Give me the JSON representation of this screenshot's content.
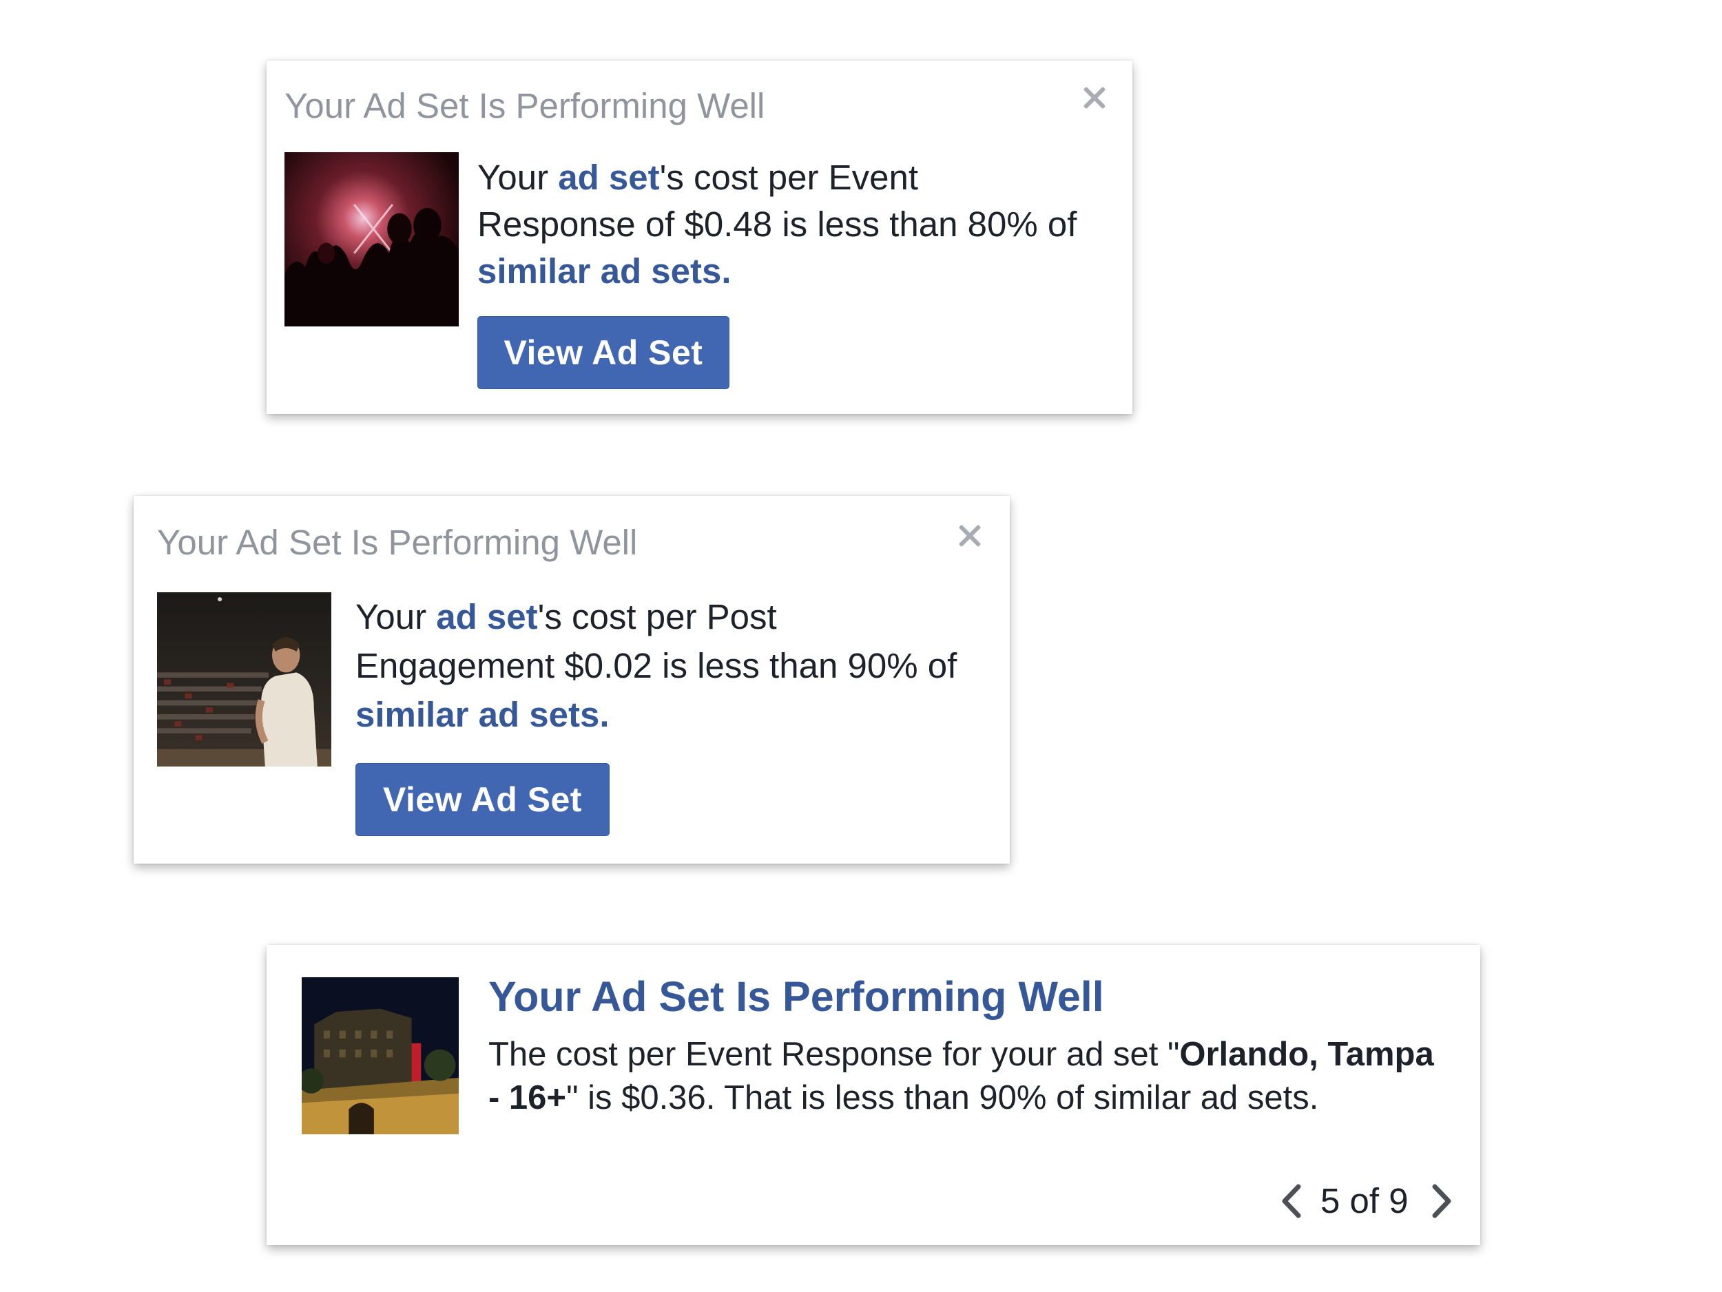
{
  "cards": [
    {
      "title": "Your Ad Set Is Performing Well",
      "body": {
        "t1": "Your ",
        "link1": "ad set",
        "t2": "'s cost per Event Response of $0.48 is less than 80% of ",
        "link2": "similar ad sets",
        "t3": "."
      },
      "button_label": "View Ad Set",
      "close_icon": "close-icon",
      "thumbnail": "concert-crowd-image"
    },
    {
      "title": "Your Ad Set Is Performing Well",
      "body": {
        "t1": "Your ",
        "link1": "ad set",
        "t2": "'s cost per Post Engagement $0.02 is less than 90% of ",
        "link2": "similar ad sets",
        "t3": "."
      },
      "button_label": "View Ad Set",
      "close_icon": "close-icon",
      "thumbnail": "performer-on-stage-image"
    },
    {
      "title": "Your Ad Set Is Performing Well",
      "body": {
        "t1": "The cost per Event Response for your ad set \"",
        "bold": "Orlando, Tampa - 16+",
        "t2": "\" is $0.36. That is less than 90% of similar ad sets."
      },
      "pager": "5 of 9",
      "thumbnail": "theater-building-night-image"
    }
  ],
  "colors": {
    "link": "#365899",
    "button": "#4267b2",
    "title_grey": "#90949c",
    "text": "#1d2129"
  }
}
